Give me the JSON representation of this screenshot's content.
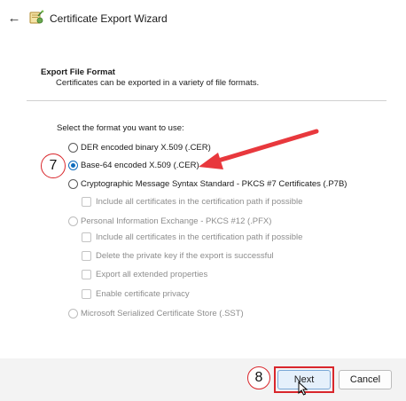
{
  "window": {
    "title": "Certificate Export Wizard",
    "back_glyph": "←",
    "icon": "certificate-wizard-icon"
  },
  "header": {
    "heading": "Export File Format",
    "description": "Certificates can be exported in a variety of file formats."
  },
  "body": {
    "prompt": "Select the format you want to use:",
    "options": [
      {
        "label": "DER encoded binary X.509 (.CER)",
        "checked": false,
        "enabled": true
      },
      {
        "label": "Base-64 encoded X.509 (.CER)",
        "checked": true,
        "enabled": true
      },
      {
        "label": "Cryptographic Message Syntax Standard - PKCS #7 Certificates (.P7B)",
        "checked": false,
        "enabled": true
      },
      {
        "label": "Personal Information Exchange - PKCS #12 (.PFX)",
        "checked": false,
        "enabled": false
      },
      {
        "label": "Microsoft Serialized Certificate Store (.SST)",
        "checked": false,
        "enabled": false
      }
    ],
    "p7b_checks": [
      {
        "label": "Include all certificates in the certification path if possible",
        "checked": false,
        "enabled": false
      }
    ],
    "pfx_checks": [
      {
        "label": "Include all certificates in the certification path if possible",
        "checked": false,
        "enabled": false
      },
      {
        "label": "Delete the private key if the export is successful",
        "checked": false,
        "enabled": false
      },
      {
        "label": "Export all extended properties",
        "checked": false,
        "enabled": false
      },
      {
        "label": "Enable certificate privacy",
        "checked": false,
        "enabled": false
      }
    ]
  },
  "annotations": {
    "step_a": "7",
    "step_b": "8",
    "color": "#d9262b"
  },
  "footer": {
    "next_label": "Next",
    "cancel_label": "Cancel"
  },
  "colors": {
    "accent": "#0f6cbd",
    "footer_bg": "#f3f3f3"
  }
}
